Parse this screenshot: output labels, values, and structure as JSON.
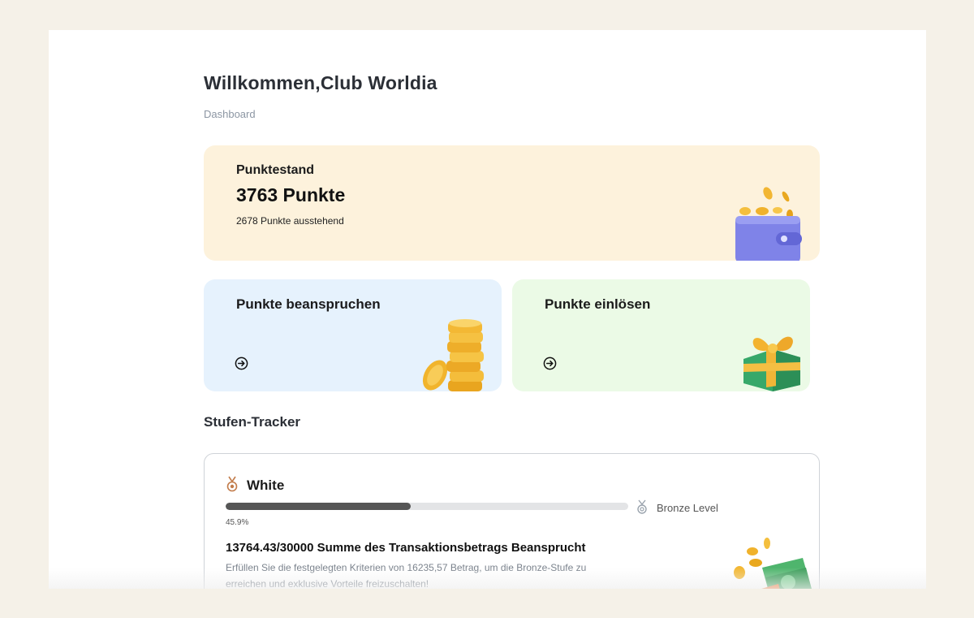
{
  "header": {
    "title": "Willkommen,Club Worldia",
    "breadcrumb": "Dashboard"
  },
  "points_card": {
    "label": "Punktestand",
    "value": "3763 Punkte",
    "pending": "2678 Punkte ausstehend"
  },
  "actions": [
    {
      "title": "Punkte beanspruchen",
      "icon": "arrow-right-circle-icon"
    },
    {
      "title": "Punkte einlösen",
      "icon": "arrow-right-circle-icon"
    }
  ],
  "tracker": {
    "section_title": "Stufen-Tracker",
    "current_tier": "White",
    "progress_percent": 45.9,
    "progress_label": "45.9%",
    "next_tier": "Bronze Level",
    "requirement": "13764.43/30000 Summe des Transaktionsbetrags Beansprucht",
    "description": "Erfüllen Sie die festgelegten Kriterien von 16235,57 Betrag, um die Bronze-Stufe zu erreichen und exklusive Vorteile freizuschalten!"
  },
  "colors": {
    "page_bg": "#f5f1e8",
    "points_card_bg": "#fdf2dc",
    "claim_card_bg": "#e6f2fd",
    "redeem_card_bg": "#ebfae6",
    "progress_fill": "#565656"
  }
}
